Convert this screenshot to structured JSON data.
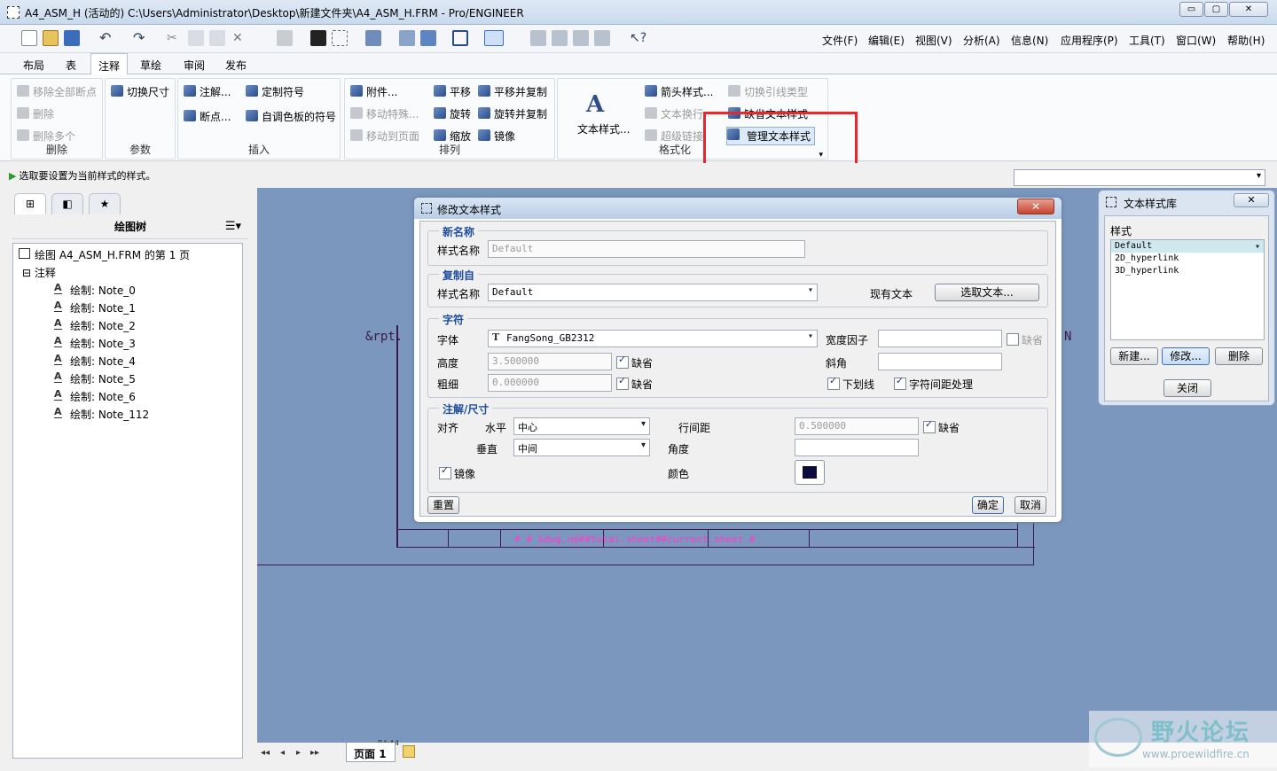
{
  "window": {
    "title": "A4_ASM_H (活动的) C:\\Users\\Administrator\\Desktop\\新建文件夹\\A4_ASM_H.FRM - Pro/ENGINEER",
    "min": "▭",
    "max": "▢",
    "close": "✕"
  },
  "menu": [
    "文件(F)",
    "编辑(E)",
    "视图(V)",
    "分析(A)",
    "信息(N)",
    "应用程序(P)",
    "工具(T)",
    "窗口(W)",
    "帮助(H)"
  ],
  "tabs": [
    "布局",
    "表",
    "注释",
    "草绘",
    "审阅",
    "发布"
  ],
  "ribbon": {
    "delete": {
      "items": [
        "移除全部断点",
        "删除",
        "删除多个"
      ],
      "label": "删除"
    },
    "params": {
      "items": [
        "切换尺寸"
      ],
      "label": "参数"
    },
    "insert": {
      "items": [
        "注解...",
        "定制符号",
        "断点...",
        "自调色板的符号"
      ],
      "label": "插入"
    },
    "arrange": {
      "items": [
        "附件...",
        "平移",
        "平移并复制",
        "移动特殊...",
        "旋转",
        "旋转并复制",
        "移动到页面",
        "缩放",
        "镜像"
      ],
      "label": "排列"
    },
    "format": {
      "big": "文本样式...",
      "items": [
        "箭头样式...",
        "切换引线类型",
        "文本换行",
        "缺省文本样式",
        "超级链接",
        "管理文本样式"
      ],
      "label": "格式化"
    }
  },
  "status": {
    "message": "选取要设置为当前样式的样式。"
  },
  "tree": {
    "title": "绘图树",
    "root": "绘图 A4_ASM_H.FRM 的第 1 页",
    "group": "注释",
    "notes": [
      "绘制: Note_0",
      "绘制: Note_1",
      "绘制: Note_2",
      "绘制: Note_3",
      "绘制: Note_4",
      "绘制: Note_5",
      "绘制: Note_6",
      "绘制: Note_112"
    ]
  },
  "dialog": {
    "title": "修改文本样式",
    "close": "✕",
    "newname": {
      "section": "新名称",
      "label": "样式名称",
      "value": "Default"
    },
    "copyfrom": {
      "section": "复制自",
      "label": "样式名称",
      "value": "Default",
      "existing": "现有文本",
      "pick": "选取文本..."
    },
    "char": {
      "section": "字符",
      "font_label": "字体",
      "font": "FangSong_GB2312",
      "height_label": "高度",
      "height": "3.500000",
      "thick_label": "粗细",
      "thick": "0.000000",
      "default": "缺省",
      "width_label": "宽度因子",
      "width": "",
      "slant_label": "斜角",
      "slant": "",
      "underline": "下划线",
      "kerning": "字符间距处理"
    },
    "note": {
      "section": "注解/尺寸",
      "align": "对齐",
      "horiz_label": "水平",
      "horiz": "中心",
      "vert_label": "垂直",
      "vert": "中间",
      "spacing_label": "行间距",
      "spacing": "0.500000",
      "angle_label": "角度",
      "angle": "",
      "mirror": "镜像",
      "color_label": "颜色",
      "color": "#0c0c3a"
    },
    "reset": "重置",
    "ok": "确定",
    "cancel": "取消"
  },
  "library": {
    "title": "文本样式库",
    "close": "✕",
    "styles_label": "样式",
    "styles": [
      "Default",
      "2D_hyperlink",
      "3D_hyperlink"
    ],
    "new": "新建...",
    "modify": "修改...",
    "delete": "删除",
    "close_btn": "关闭"
  },
  "drawing": {
    "left_text": "&rpt.",
    "right_text": "N",
    "bottom_text": "# # &dwg.n@##total.sheet##current.sheet #",
    "tag": "R4:A4"
  },
  "pagebar": {
    "nav": [
      "◂◂",
      "◂",
      "▸",
      "▸▸"
    ],
    "page_label": "页面",
    "page_num": "1"
  },
  "watermark": {
    "brand": "野火论坛",
    "url": "www.proewildfire.cn"
  }
}
